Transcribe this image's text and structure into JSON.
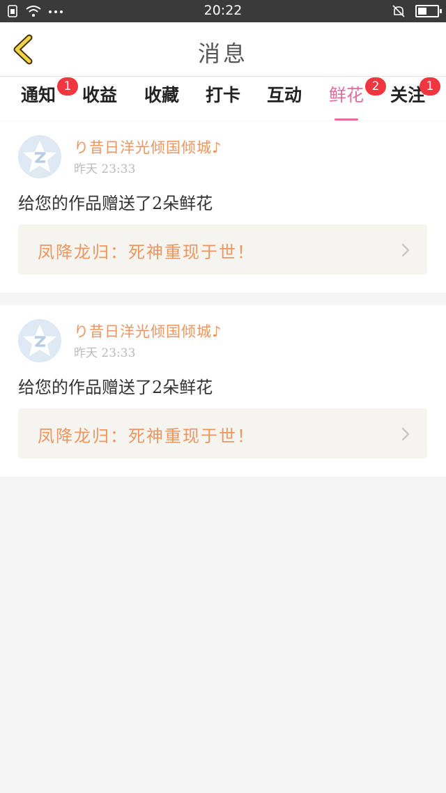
{
  "status_bar": {
    "time": "20:22",
    "icons": [
      "sim-icon",
      "wifi-icon",
      "more-dots-icon",
      "mute-icon",
      "battery-icon"
    ],
    "battery_level": 0.45
  },
  "header": {
    "title": "消息",
    "back_icon": "chevron-left-icon"
  },
  "tabs": [
    {
      "label": "通知",
      "badge": "1"
    },
    {
      "label": "收益",
      "badge": ""
    },
    {
      "label": "收藏",
      "badge": ""
    },
    {
      "label": "打卡",
      "badge": ""
    },
    {
      "label": "互动",
      "badge": ""
    },
    {
      "label": "鲜花",
      "badge": "2",
      "active": true
    },
    {
      "label": "关注",
      "badge": "1"
    }
  ],
  "messages": [
    {
      "username": "り昔日洋光倾国倾城♪",
      "time": "昨天  23:33",
      "text": "给您的作品赠送了2朵鲜花",
      "work_title": "凤降龙归：死神重现于世！"
    },
    {
      "username": "り昔日洋光倾国倾城♪",
      "time": "昨天  23:33",
      "text": "给您的作品赠送了2朵鲜花",
      "work_title": "凤降龙归：死神重现于世！"
    }
  ],
  "colors": {
    "accent": "#e76aa0",
    "badge": "#f0363f",
    "username": "#ee9560",
    "back_icon": "#f1d34a"
  }
}
